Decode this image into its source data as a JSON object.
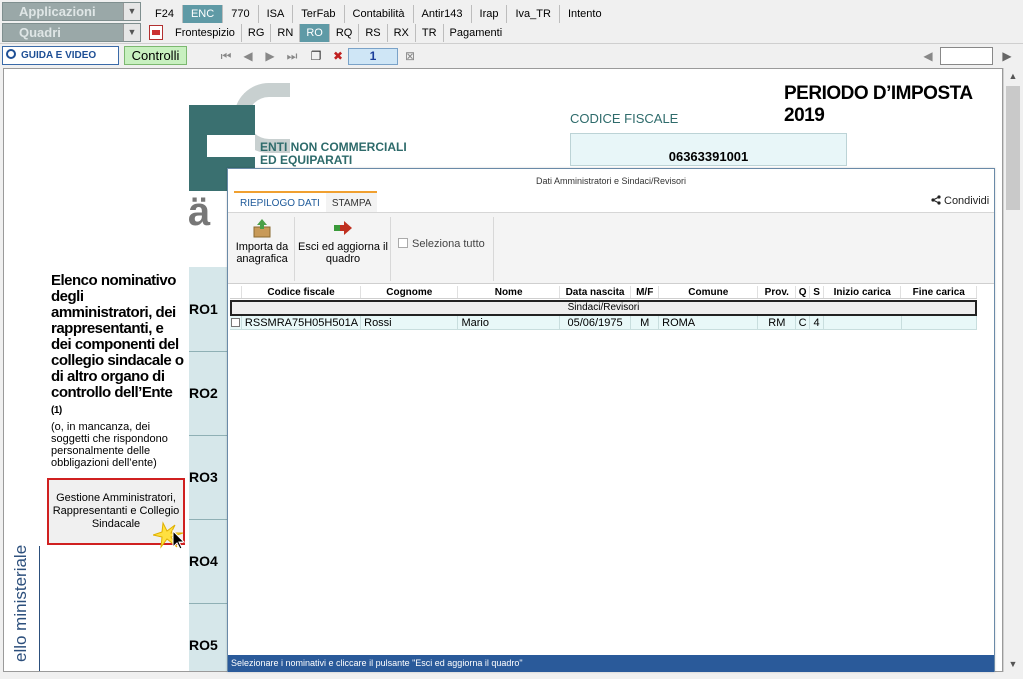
{
  "top": {
    "applicazioni": "Applicazioni",
    "quadri": "Quadri",
    "app_tabs": [
      "F24",
      "ENC",
      "770",
      "ISA",
      "TerFab",
      "Contabilità",
      "Antir143",
      "Irap",
      "Iva_TR",
      "Intento"
    ],
    "active_app": "ENC",
    "quadri_tabs": [
      "Frontespizio",
      "RG",
      "RN",
      "RO",
      "RQ",
      "RS",
      "RX",
      "TR",
      "Pagamenti"
    ],
    "active_quadro": "RO"
  },
  "toolbar": {
    "guida": "GUIDA E VIDEO",
    "controlli": "Controlli",
    "page": "1"
  },
  "doc": {
    "periodo": "PERIODO D’IMPOSTA 2019",
    "enti_line1": "ENTI NON COMMERCIALI",
    "enti_line2": "ED EQUIPARATI",
    "cf_label": "CODICE FISCALE",
    "cf_value": "06363391001",
    "elenco_title": "Elenco nominativo degli amministratori, dei rappresentanti, e dei componenti del collegio sindacale o di altro organo di controllo dell’Ente",
    "elenco_note": "(1)",
    "elenco_sub": "(o, in mancanza, dei soggetti che rispondono personalmente delle obbligazioni dell’ente)",
    "ro_rows": [
      "RO1",
      "RO2",
      "RO3",
      "RO4",
      "RO5"
    ],
    "gestione_button": "Gestione Amministratori, Rappresentanti e Collegio Sindacale",
    "ministeriale": "ello ministeriale"
  },
  "dialog": {
    "title": "Dati Amministratori e Sindaci/Revisori",
    "tabs": [
      "RIEPILOGO DATI",
      "STAMPA"
    ],
    "condividi": "Condividi",
    "importa": "Importa da anagrafica",
    "esci": "Esci ed aggiorna il quadro",
    "seleziona": "Seleziona tutto",
    "columns": [
      "Codice fiscale",
      "Cognome",
      "Nome",
      "Data nascita",
      "M/F",
      "Comune",
      "Prov.",
      "Q",
      "S",
      "Inizio carica",
      "Fine carica"
    ],
    "group": "Sindaci/Revisori",
    "rows": [
      {
        "cf": "RSSMRA75H05H501A",
        "cognome": "Rossi",
        "nome": "Mario",
        "data": "05/06/1975",
        "mf": "M",
        "comune": "ROMA",
        "prov": "RM",
        "q": "C",
        "s": "4",
        "inizio": "",
        "fine": ""
      }
    ],
    "status": "Selezionare i nominativi e cliccare il pulsante \"Esci ed aggiorna il quadro\""
  }
}
